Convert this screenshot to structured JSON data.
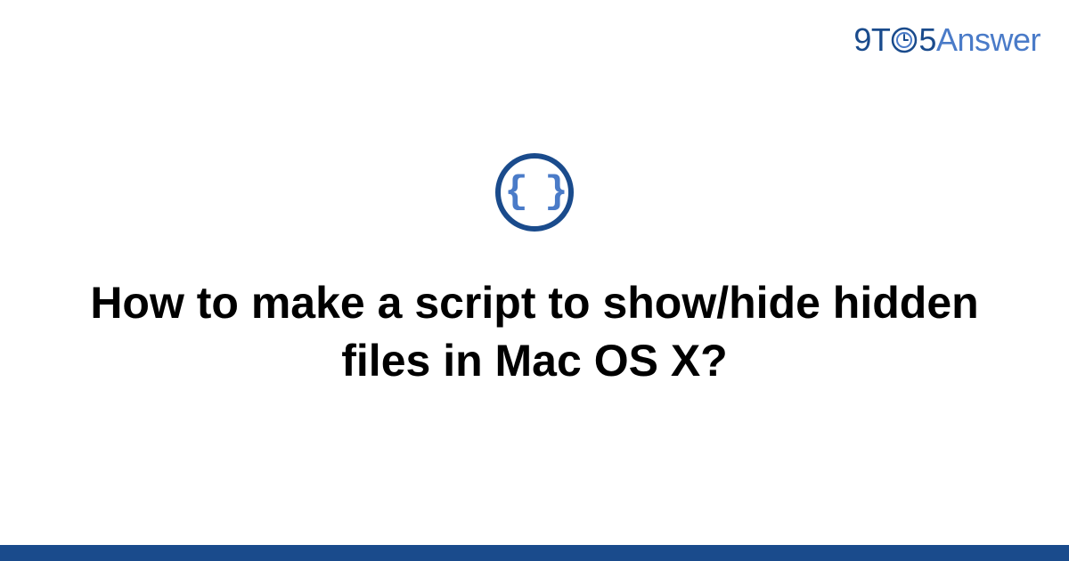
{
  "logo": {
    "part1": "9T",
    "part2": "5",
    "part3": "Answer"
  },
  "icon": {
    "braces": "{ }",
    "name": "code-braces-icon"
  },
  "title": "How to make a script to show/hide hidden files in Mac OS X?",
  "colors": {
    "primary": "#1a4b8c",
    "secondary": "#4a7bc8",
    "background": "#ffffff"
  }
}
